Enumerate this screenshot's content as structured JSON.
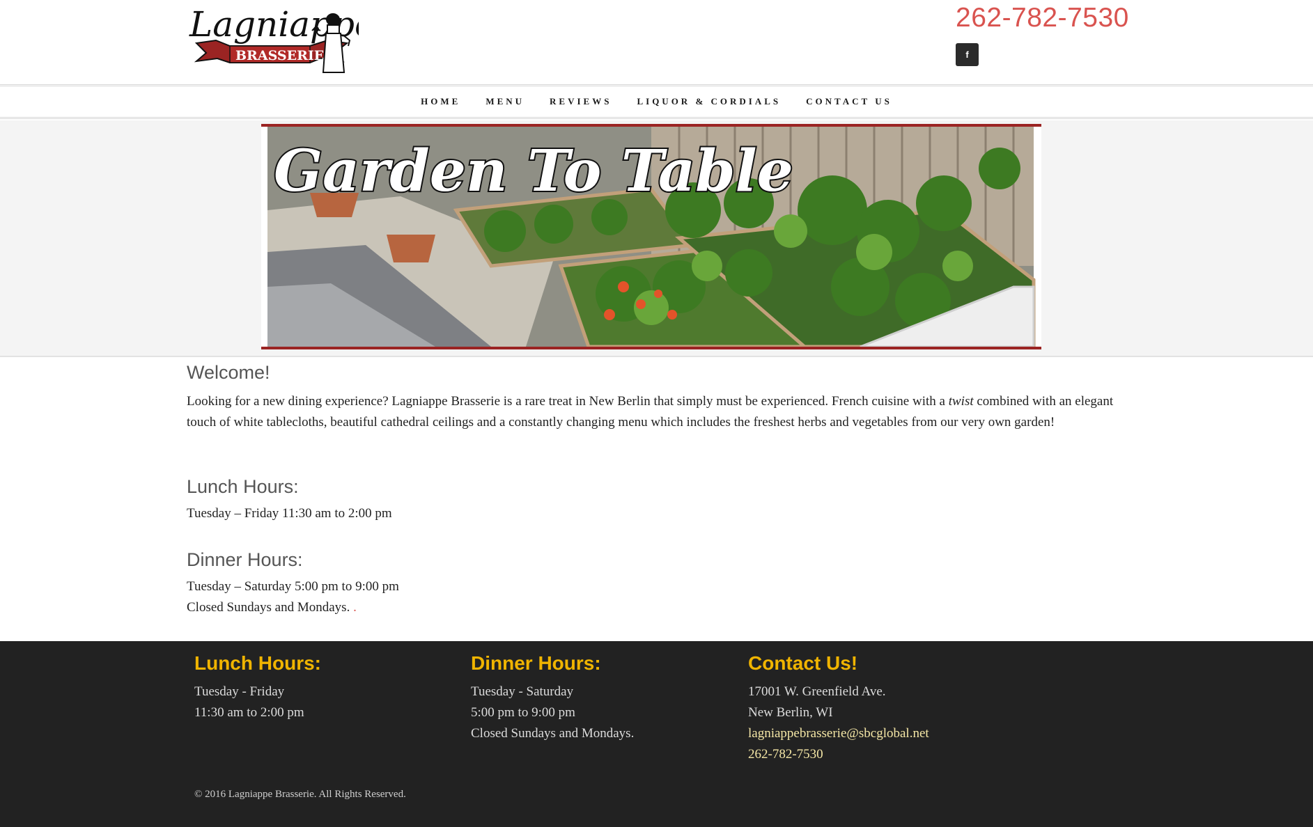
{
  "header": {
    "phone": "262-782-7530",
    "facebook_icon": "f",
    "logo": {
      "name": "Lagniappe",
      "sub": "BRASSERIE"
    }
  },
  "nav": {
    "items": [
      "HOME",
      "MENU",
      "REVIEWS",
      "LIQUOR & CORDIALS",
      "CONTACT US"
    ]
  },
  "banner": {
    "title": "Garden To Table"
  },
  "main": {
    "welcome_title": "Welcome!",
    "intro_part1": "Looking for a new dining experience?  Lagniappe Brasserie is a rare treat in New Berlin that simply must be experienced.  French cuisine with a ",
    "intro_em": "twist",
    "intro_part2": " combined with an elegant touch of white tablecloths, beautiful cathedral ceilings and a constantly changing menu which includes the freshest herbs and vegetables from our very own garden!",
    "lunch_title": "Lunch Hours:",
    "lunch_text": "Tuesday – Friday 11:30 am to 2:00 pm",
    "dinner_title": "Dinner Hours:",
    "dinner_text": "Tuesday – Saturday 5:00 pm to 9:00 pm",
    "closed_text": "Closed Sundays and Mondays. ",
    "closed_dot": "."
  },
  "footer": {
    "lunch": {
      "title": "Lunch Hours:",
      "line1": "Tuesday - Friday",
      "line2": "11:30 am to 2:00 pm"
    },
    "dinner": {
      "title": "Dinner Hours:",
      "line1": "Tuesday - Saturday",
      "line2": "5:00 pm to 9:00 pm",
      "line3": "Closed Sundays and Mondays."
    },
    "contact": {
      "title": "Contact Us!",
      "address1": "17001 W. Greenfield Ave.",
      "address2": "New Berlin, WI",
      "email": "lagniappebrasserie@sbcglobal.net",
      "phone": "262-782-7530"
    },
    "copyright": "© 2016 Lagniappe Brasserie. All Rights Reserved."
  },
  "colors": {
    "accent_red": "#d9534f",
    "banner_border": "#9b2423",
    "footer_heading": "#f0b400",
    "footer_bg": "#222222"
  }
}
